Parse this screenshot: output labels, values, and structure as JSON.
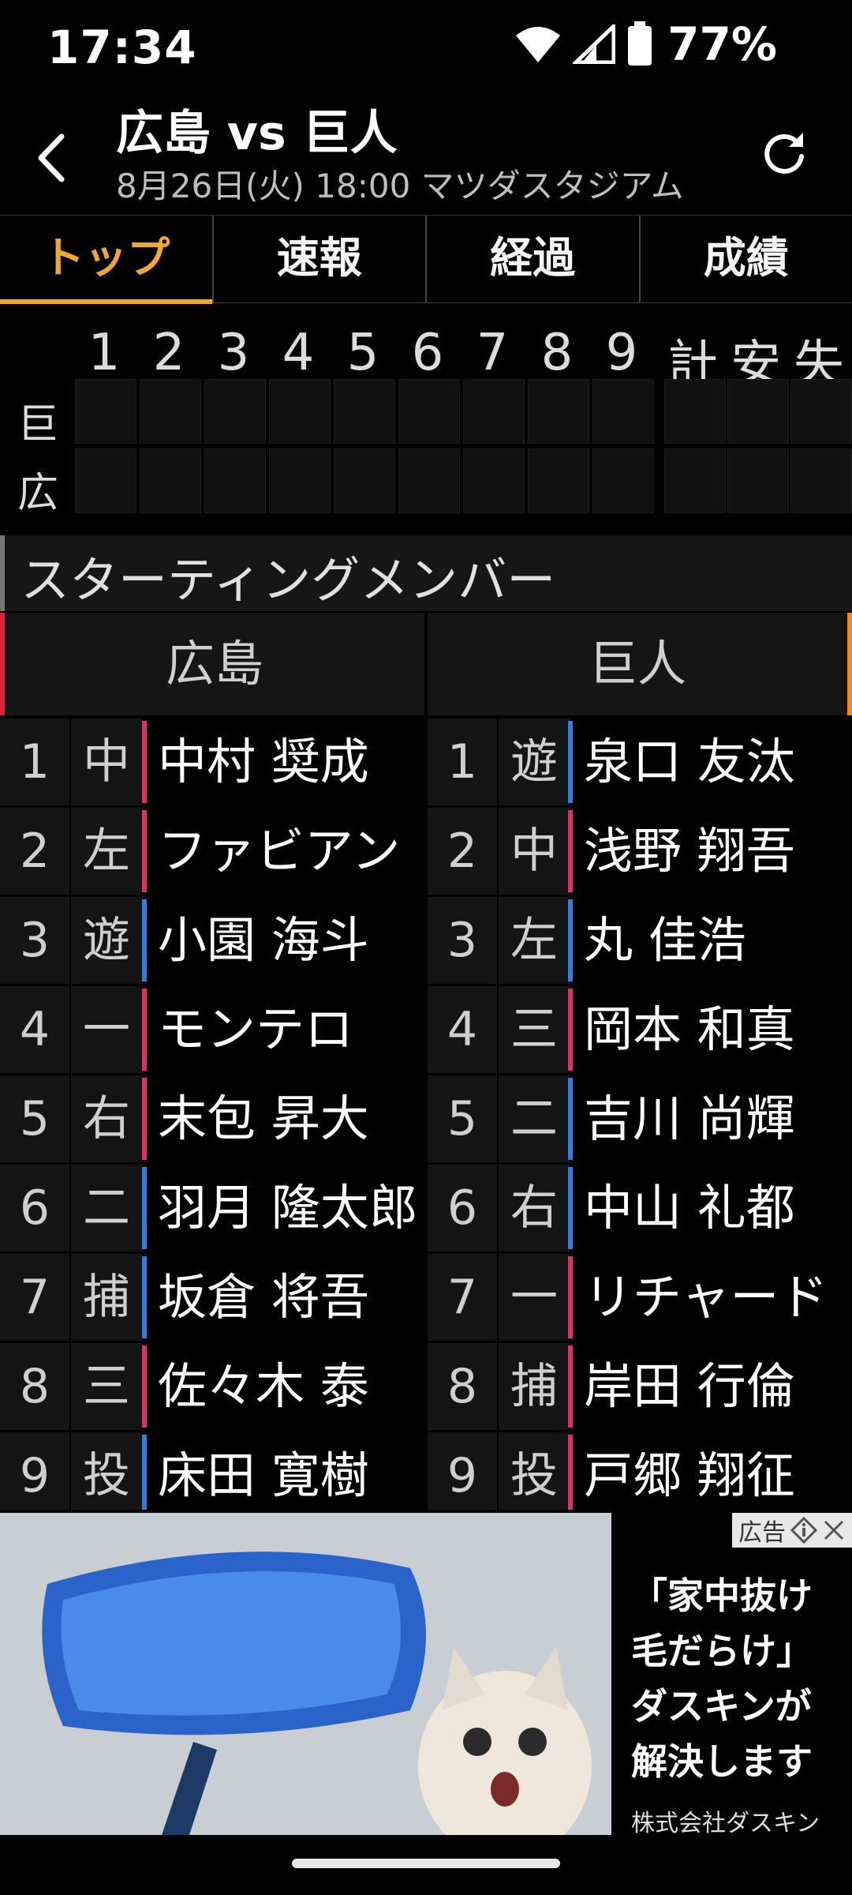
{
  "status": {
    "time": "17:34",
    "battery": "77%"
  },
  "header": {
    "title": "広島 vs 巨人",
    "subtitle": "8月26日(火) 18:00 マツダスタジアム"
  },
  "tabs": [
    {
      "label": "トップ",
      "active": true
    },
    {
      "label": "速報",
      "active": false
    },
    {
      "label": "経過",
      "active": false
    },
    {
      "label": "成績",
      "active": false
    }
  ],
  "scoreboard": {
    "innings": [
      "1",
      "2",
      "3",
      "4",
      "5",
      "6",
      "7",
      "8",
      "9"
    ],
    "totals": [
      "計",
      "安",
      "失"
    ],
    "teams": [
      "巨",
      "広"
    ]
  },
  "section_title": "スターティングメンバー",
  "lineup": {
    "home": {
      "team": "広島",
      "color": "#e0203a"
    },
    "away": {
      "team": "巨人",
      "color": "#f08a1c"
    },
    "rows": [
      {
        "n": "1",
        "hp": "中",
        "hn": "中村 奨成",
        "hc": "#e0306a",
        "ap": "遊",
        "an": "泉口 友汰",
        "ac": "#2f7de1"
      },
      {
        "n": "2",
        "hp": "左",
        "hn": "ファビアン",
        "hc": "#e0306a",
        "ap": "中",
        "an": "浅野 翔吾",
        "ac": "#e0306a"
      },
      {
        "n": "3",
        "hp": "遊",
        "hn": "小園 海斗",
        "hc": "#2f7de1",
        "ap": "左",
        "an": "丸 佳浩",
        "ac": "#2f7de1"
      },
      {
        "n": "4",
        "hp": "一",
        "hn": "モンテロ",
        "hc": "#e0306a",
        "ap": "三",
        "an": "岡本 和真",
        "ac": "#e0306a"
      },
      {
        "n": "5",
        "hp": "右",
        "hn": "末包 昇大",
        "hc": "#e0306a",
        "ap": "二",
        "an": "吉川 尚輝",
        "ac": "#2f7de1"
      },
      {
        "n": "6",
        "hp": "二",
        "hn": "羽月 隆太郎",
        "hc": "#2f7de1",
        "ap": "右",
        "an": "中山 礼都",
        "ac": "#2f7de1"
      },
      {
        "n": "7",
        "hp": "捕",
        "hn": "坂倉 将吾",
        "hc": "#2f7de1",
        "ap": "一",
        "an": "リチャード",
        "ac": "#e0306a"
      },
      {
        "n": "8",
        "hp": "三",
        "hn": "佐々木 泰",
        "hc": "#e0306a",
        "ap": "捕",
        "an": "岸田 行倫",
        "ac": "#e0306a"
      },
      {
        "n": "9",
        "hp": "投",
        "hn": "床田 寛樹",
        "hc": "#2f7de1",
        "ap": "投",
        "an": "戸郷 翔征",
        "ac": "#e0306a"
      }
    ]
  },
  "ad": {
    "badge": "広告",
    "message": [
      "「家中抜け",
      "毛だらけ」",
      "ダスキンが",
      "解決します"
    ],
    "company": "株式会社ダスキン"
  }
}
